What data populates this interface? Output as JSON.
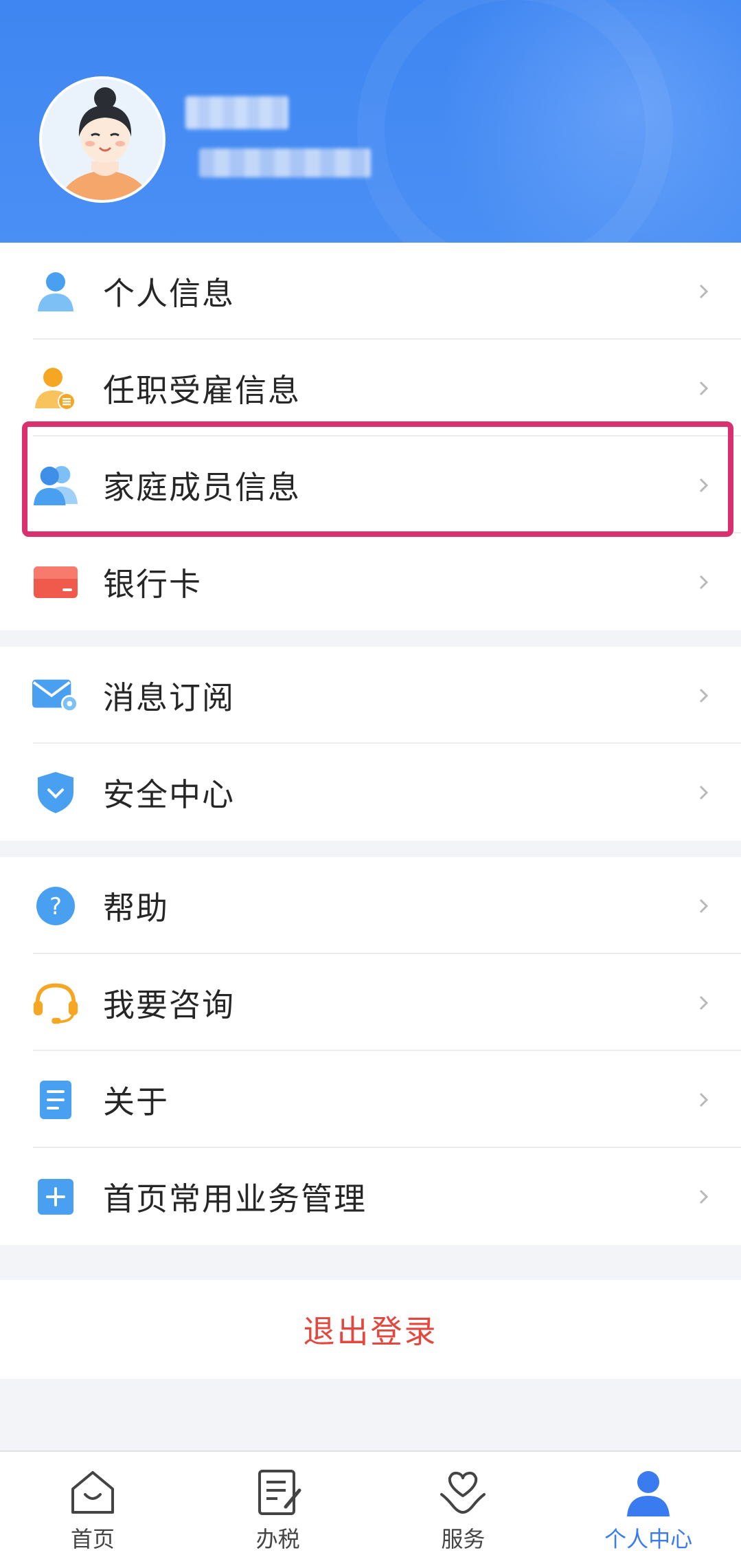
{
  "header": {
    "user_name": "",
    "user_id": "",
    "colors": {
      "bg": "#4a8ff4"
    }
  },
  "menu": {
    "group1": [
      {
        "label": "个人信息",
        "icon": "person-icon"
      },
      {
        "label": "任职受雇信息",
        "icon": "employment-icon"
      },
      {
        "label": "家庭成员信息",
        "icon": "family-icon",
        "highlighted": true
      },
      {
        "label": "银行卡",
        "icon": "bank-card-icon"
      }
    ],
    "group2": [
      {
        "label": "消息订阅",
        "icon": "mail-settings-icon"
      },
      {
        "label": "安全中心",
        "icon": "shield-icon"
      }
    ],
    "group3": [
      {
        "label": "帮助",
        "icon": "help-icon"
      },
      {
        "label": "我要咨询",
        "icon": "headset-icon"
      },
      {
        "label": "关于",
        "icon": "document-icon"
      },
      {
        "label": "首页常用业务管理",
        "icon": "plus-icon"
      }
    ]
  },
  "logout_label": "退出登录",
  "tabbar": [
    {
      "label": "首页",
      "icon": "home-icon",
      "active": false
    },
    {
      "label": "办税",
      "icon": "tax-form-icon",
      "active": false
    },
    {
      "label": "服务",
      "icon": "service-heart-icon",
      "active": false
    },
    {
      "label": "个人中心",
      "icon": "profile-icon",
      "active": true
    }
  ],
  "colors": {
    "accent": "#3a7cf0",
    "highlight_border": "#d9306f",
    "logout": "#e4473d"
  }
}
